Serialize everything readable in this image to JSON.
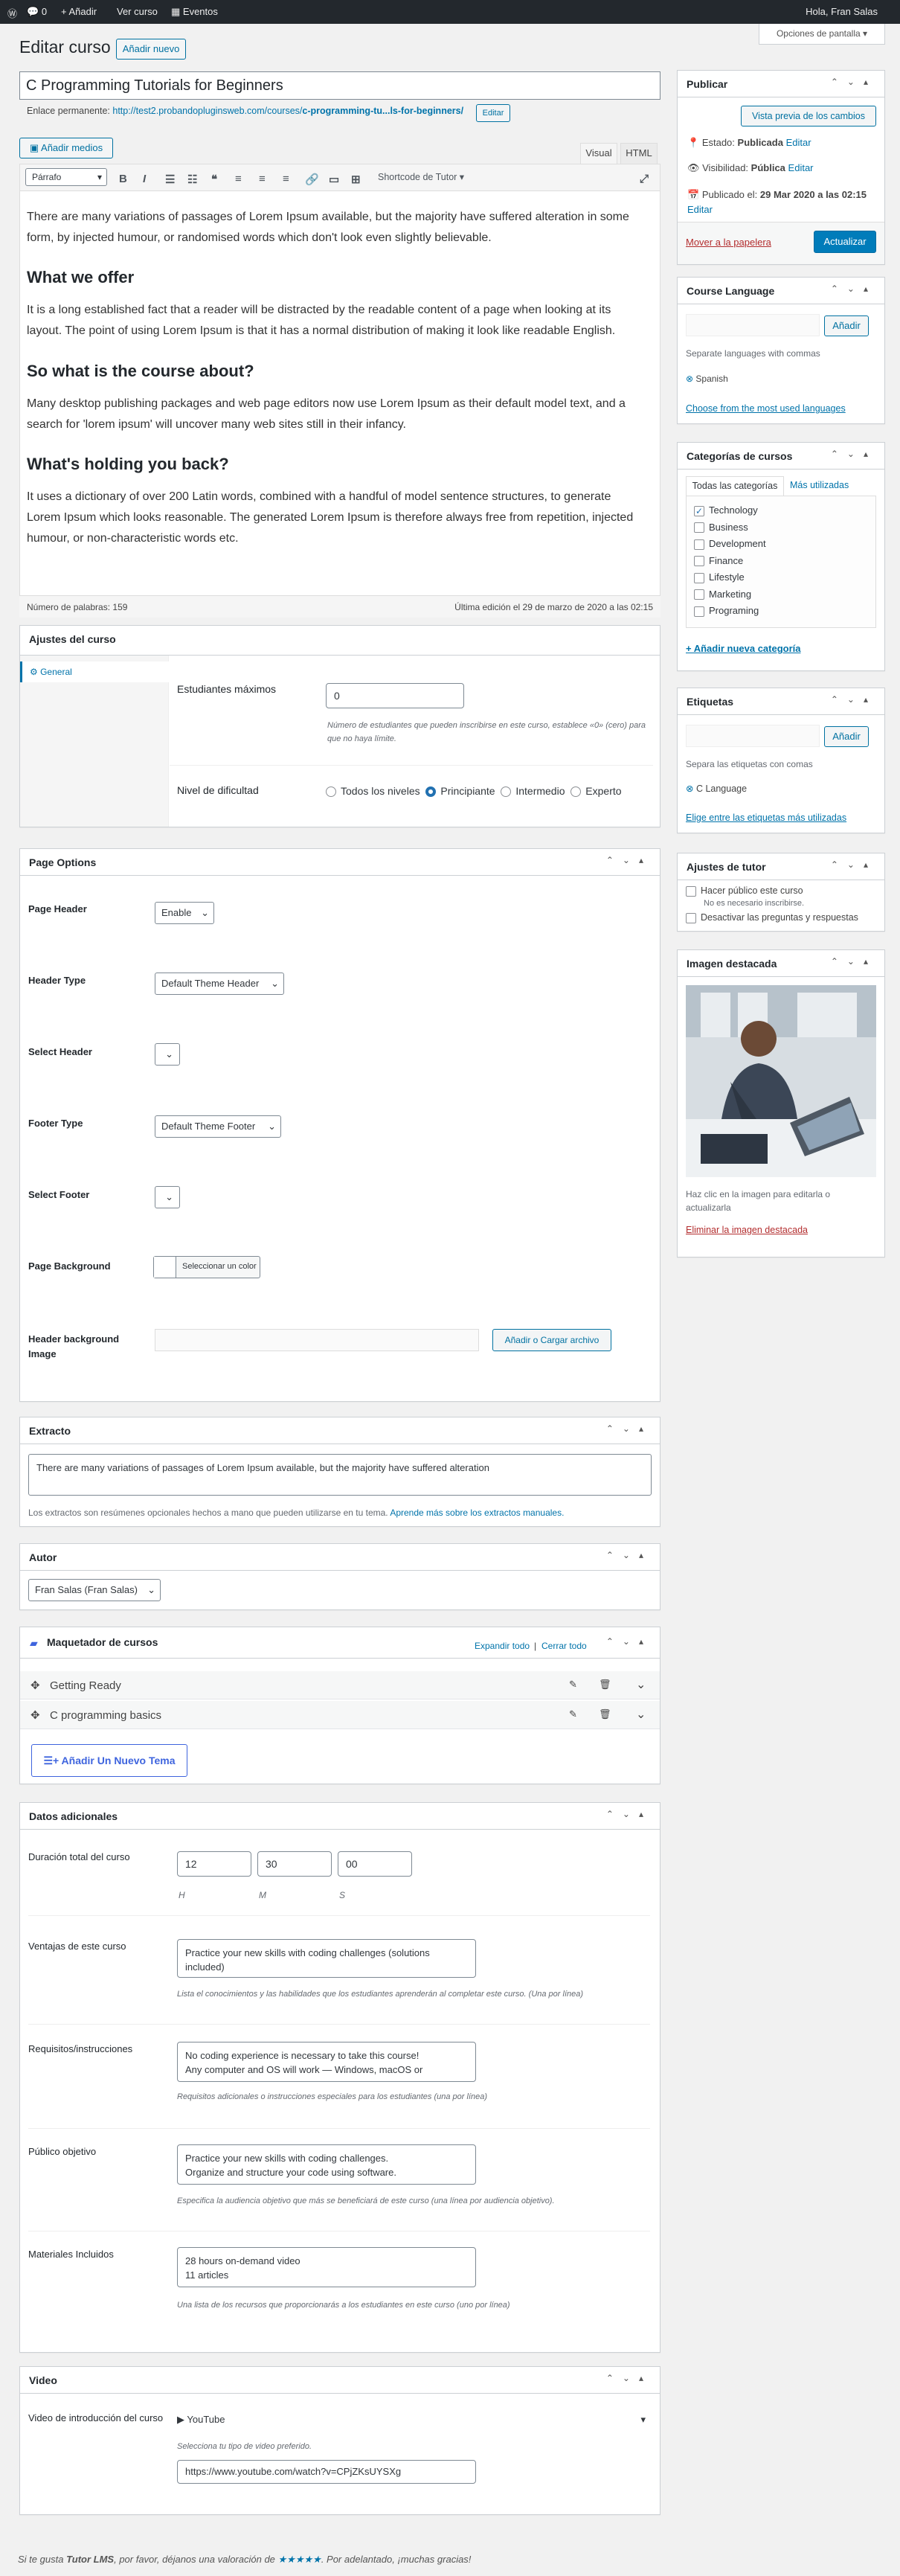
{
  "adminbar": {
    "comments": "0",
    "new": "Añadir",
    "view": "Ver curso",
    "events": "Eventos",
    "greeting": "Hola, Fran Salas"
  },
  "screen_options": "Opciones de pantalla ▾",
  "page": {
    "title": "Editar curso",
    "add_new": "Añadir nuevo"
  },
  "post": {
    "title": "C Programming Tutorials for Beginners",
    "permalink_label": "Enlace permanente:",
    "permalink_base": "http://test2.probandopluginsweb.com/courses/",
    "permalink_slug": "c-programming-tu...ls-for-beginners/",
    "permalink_edit": "Editar"
  },
  "editor": {
    "add_media": "Añadir medios",
    "tab_visual": "Visual",
    "tab_html": "HTML",
    "format": "Párrafo",
    "shortcode": "Shortcode de Tutor ▾",
    "p1": "There are many variations of passages of Lorem Ipsum available, but the majority have suffered alteration in some form, by injected humour, or randomised words which don't look even slightly believable.",
    "h1": "What we offer",
    "p2": "It is a long established fact that a reader will be distracted by the readable content of a page when looking at its layout. The point of using Lorem Ipsum is that it has a normal distribution of making it look like readable English.",
    "h2": "So what is the course about?",
    "p3": "Many desktop publishing packages and web page editors now use Lorem Ipsum as their default model text, and a search for 'lorem ipsum' will uncover many web sites still in their infancy.",
    "h3": "What's holding you back?",
    "p4": "It uses a dictionary of over 200 Latin words, combined with a handful of model sentence structures, to generate Lorem Ipsum which looks reasonable. The generated Lorem Ipsum is therefore always free from repetition, injected humour, or non-characteristic words etc.",
    "word_count": "Número de palabras: 159",
    "last_edit": "Última edición el 29 de marzo de 2020 a las 02:15"
  },
  "course_settings": {
    "title": "Ajustes del curso",
    "tab": "General",
    "max_students_label": "Estudiantes máximos",
    "max_students_value": "0",
    "max_students_desc": "Número de estudiantes que pueden inscribirse en este curso, establece «0» (cero) para que no haya límite.",
    "difficulty_label": "Nivel de dificultad",
    "levels": [
      "Todos los niveles",
      "Principiante",
      "Intermedio",
      "Experto"
    ]
  },
  "page_options": {
    "title": "Page Options",
    "page_header": "Page Header",
    "page_header_val": "Enable",
    "header_type": "Header Type",
    "header_type_val": "Default Theme Header",
    "select_header": "Select Header",
    "footer_type": "Footer Type",
    "footer_type_val": "Default Theme Footer",
    "select_footer": "Select Footer",
    "page_bg": "Page Background",
    "color_btn": "Seleccionar un color",
    "header_bg": "Header background Image",
    "upload_btn": "Añadir o Cargar archivo"
  },
  "excerpt": {
    "title": "Extracto",
    "value": "There are many variations of passages of Lorem Ipsum available, but the majority have suffered alteration",
    "help": "Los extractos son resúmenes opcionales hechos a mano que pueden utilizarse en tu tema.",
    "link": "Aprende más sobre los extractos manuales."
  },
  "author": {
    "title": "Autor",
    "value": "Fran Salas (Fran Salas)"
  },
  "builder": {
    "title": "Maquetador de cursos",
    "expand": "Expandir todo",
    "sep": "|",
    "collapse": "Cerrar todo",
    "topics": [
      "Getting Ready",
      "C programming basics"
    ],
    "add_topic": "Añadir Un Nuevo Tema"
  },
  "extra": {
    "title": "Datos adicionales",
    "duration_label": "Duración total del curso",
    "h": "12",
    "m": "30",
    "s": "00",
    "h_l": "H",
    "m_l": "M",
    "s_l": "S",
    "benefits_label": "Ventajas de este curso",
    "benefits_val": "Practice your new skills with coding challenges (solutions included)",
    "benefits_desc": "Lista el conocimientos y las habilidades que los estudiantes aprenderán al completar este curso. (Una por línea)",
    "req_label": "Requisitos/instrucciones",
    "req_val1": "No coding experience is necessary to take this course!",
    "req_val2": "Any computer and OS will work — Windows, macOS or",
    "req_desc": "Requisitos adicionales o instrucciones especiales para los estudiantes (una por línea)",
    "aud_label": "Público objetivo",
    "aud_val1": "Practice your new skills with coding challenges.",
    "aud_val2": "Organize and structure your code using software.",
    "aud_desc": "Especifica la audiencia objetivo que más se beneficiará de este curso (una línea por audiencia objetivo).",
    "mat_label": "Materiales Incluidos",
    "mat_val1": "28 hours on-demand video",
    "mat_val2": "11 articles",
    "mat_desc": "Una lista de los recursos que proporcionarás a los estudiantes en este curso (uno por línea)"
  },
  "video": {
    "title": "Video",
    "label": "Video de introducción del curso",
    "source": "YouTube",
    "source_desc": "Selecciona tu tipo de video preferido.",
    "url": "https://www.youtube.com/watch?v=CPjZKsUYSXg"
  },
  "publish": {
    "title": "Publicar",
    "preview": "Vista previa de los cambios",
    "status_l": "Estado:",
    "status_v": "Publicada",
    "edit": "Editar",
    "vis_l": "Visibilidad:",
    "vis_v": "Pública",
    "pub_l": "Publicado el:",
    "pub_v": "29 Mar 2020 a las 02:15",
    "trash": "Mover a la papelera",
    "update": "Actualizar"
  },
  "language": {
    "title": "Course Language",
    "add": "Añadir",
    "sep_help": "Separate languages with commas",
    "tag": "Spanish",
    "choose": "Choose from the most used languages"
  },
  "categories": {
    "title": "Categorías de cursos",
    "tab_all": "Todas las categorías",
    "tab_used": "Más utilizadas",
    "items": [
      "Technology",
      "Business",
      "Development",
      "Finance",
      "Lifestyle",
      "Marketing",
      "Programing"
    ],
    "add": "+ Añadir nueva categoría"
  },
  "tags": {
    "title": "Etiquetas",
    "add": "Añadir",
    "help": "Separa las etiquetas con comas",
    "tag": "C Language",
    "choose": "Elige entre las etiquetas más utilizadas"
  },
  "tutor": {
    "title": "Ajustes de tutor",
    "public": "Hacer público este curso",
    "public_note": "No es necesario inscribirse.",
    "qa": "Desactivar las preguntas y respuestas"
  },
  "featured": {
    "title": "Imagen destacada",
    "help": "Haz clic en la imagen para editarla o actualizarla",
    "remove": "Eliminar la imagen destacada"
  },
  "footer": {
    "a": "Si te gusta",
    "b": "Tutor LMS",
    "c": ", por favor, déjanos una valoración de",
    "stars": "★★★★★",
    "d": ". Por adelantado, ¡muchas gracias!"
  }
}
